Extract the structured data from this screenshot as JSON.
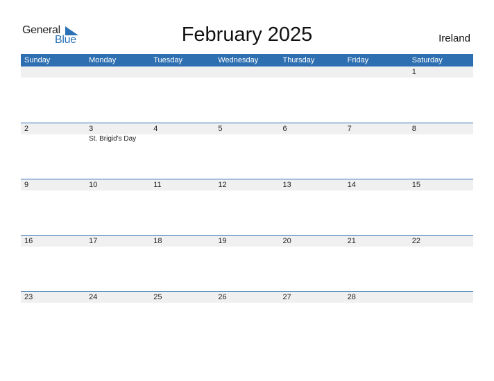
{
  "logo": {
    "word1": "General",
    "word2": "Blue"
  },
  "title": "February 2025",
  "country": "Ireland",
  "colors": {
    "accent": "#2e6fb1",
    "row_shade": "#f0f0f0"
  },
  "weekdays": [
    "Sunday",
    "Monday",
    "Tuesday",
    "Wednesday",
    "Thursday",
    "Friday",
    "Saturday"
  ],
  "weeks": [
    {
      "days": [
        "",
        "",
        "",
        "",
        "",
        "",
        "1"
      ],
      "holidays": [
        "",
        "",
        "",
        "",
        "",
        "",
        ""
      ]
    },
    {
      "days": [
        "2",
        "3",
        "4",
        "5",
        "6",
        "7",
        "8"
      ],
      "holidays": [
        "",
        "St. Brigid's Day",
        "",
        "",
        "",
        "",
        ""
      ]
    },
    {
      "days": [
        "9",
        "10",
        "11",
        "12",
        "13",
        "14",
        "15"
      ],
      "holidays": [
        "",
        "",
        "",
        "",
        "",
        "",
        ""
      ]
    },
    {
      "days": [
        "16",
        "17",
        "18",
        "19",
        "20",
        "21",
        "22"
      ],
      "holidays": [
        "",
        "",
        "",
        "",
        "",
        "",
        ""
      ]
    },
    {
      "days": [
        "23",
        "24",
        "25",
        "26",
        "27",
        "28",
        ""
      ],
      "holidays": [
        "",
        "",
        "",
        "",
        "",
        "",
        ""
      ]
    }
  ]
}
